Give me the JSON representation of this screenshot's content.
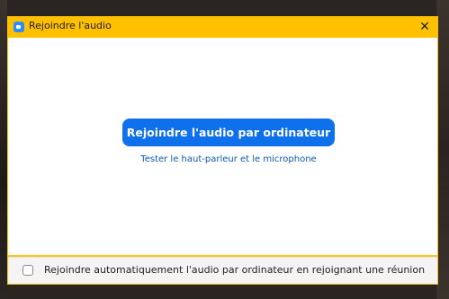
{
  "window": {
    "title": "Rejoindre l'audio",
    "close_glyph": "✕"
  },
  "main": {
    "join_button_label": "Rejoindre l'audio par ordinateur",
    "test_link_label": "Tester le haut-parleur et le microphone"
  },
  "footer": {
    "auto_join_label": "Rejoindre automatiquement l'audio par ordinateur en rejoignant une réunion",
    "auto_join_checked": false
  },
  "colors": {
    "titlebar": "#ffc000",
    "accent_button": "#0e71eb",
    "link": "#0e5ab8"
  },
  "icons": {
    "app": "zoom-camera-icon",
    "close": "close-icon"
  }
}
